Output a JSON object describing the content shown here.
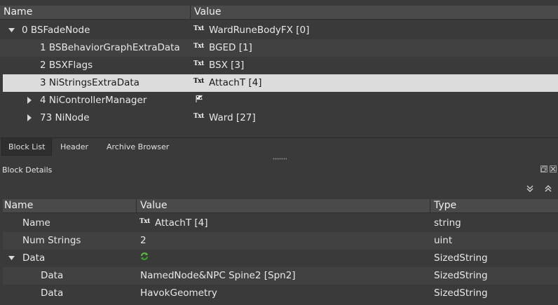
{
  "top_tree": {
    "headers": {
      "name": "Name",
      "value": "Value"
    },
    "rows": [
      {
        "name": "0 BSFadeNode",
        "value": "WardRuneBodyFX [0]",
        "icon": "txt-icon",
        "expand": "expanded"
      },
      {
        "name": "1 BSBehaviorGraphExtraData",
        "value": "BGED [1]",
        "icon": "txt-icon",
        "expand": "none"
      },
      {
        "name": "2 BSXFlags",
        "value": "BSX [3]",
        "icon": "txt-icon",
        "expand": "none"
      },
      {
        "name": "3 NiStringsExtraData",
        "value": "AttachT [4]",
        "icon": "txt-icon",
        "expand": "none",
        "selected": true
      },
      {
        "name": "4 NiControllerManager",
        "value": "",
        "icon": "flag-icon",
        "expand": "collapsed"
      },
      {
        "name": "73 NiNode",
        "value": "Ward [27]",
        "icon": "txt-icon",
        "expand": "collapsed"
      }
    ]
  },
  "tabs": [
    {
      "label": "Block List",
      "active": true
    },
    {
      "label": "Header",
      "active": false
    },
    {
      "label": "Archive Browser",
      "active": false
    }
  ],
  "details": {
    "title": "Block Details",
    "headers": {
      "name": "Name",
      "value": "Value",
      "type": "Type"
    },
    "rows": [
      {
        "name": "Name",
        "value": "AttachT [4]",
        "type": "string",
        "icon": "txt-icon",
        "expand": "none"
      },
      {
        "name": "Num Strings",
        "value": "2",
        "type": "uint",
        "icon": "",
        "expand": "none"
      },
      {
        "name": "Data",
        "value": "",
        "type": "SizedString",
        "icon": "refresh-icon",
        "expand": "expanded"
      },
      {
        "name": "Data",
        "value": "NamedNode&NPC Spine2 [Spn2]",
        "type": "SizedString",
        "icon": "",
        "expand": "none"
      },
      {
        "name": "Data",
        "value": "HavokGeometry",
        "type": "SizedString",
        "icon": "",
        "expand": "none"
      }
    ]
  },
  "icon_text": {
    "txt": "Txt"
  },
  "colors": {
    "selection": "#dcdcdc",
    "background": "#3a3a3a",
    "header": "#4a4a4a",
    "refresh_green": "#4caf50"
  }
}
